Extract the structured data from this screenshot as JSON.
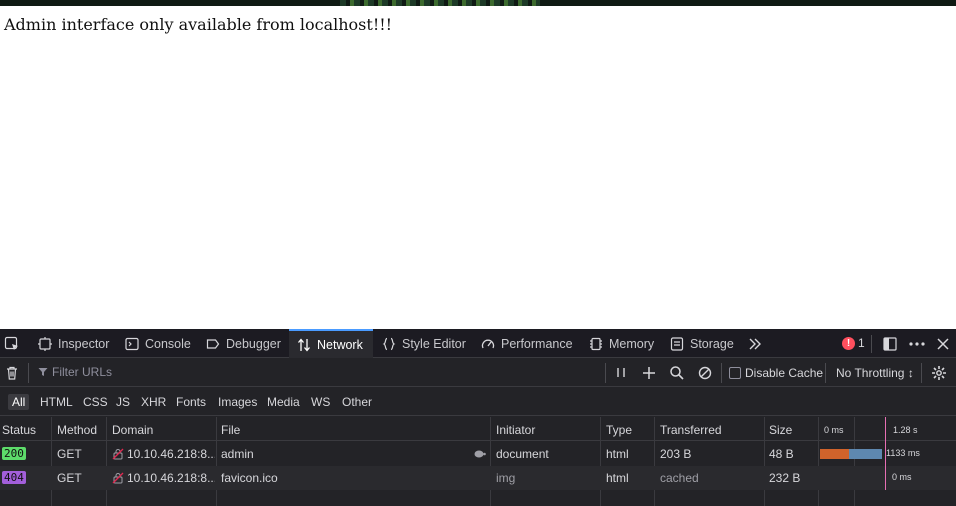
{
  "page": {
    "message": "Admin interface only available from localhost!!!"
  },
  "devtools": {
    "tabs": [
      {
        "label": "Inspector"
      },
      {
        "label": "Console"
      },
      {
        "label": "Debugger"
      },
      {
        "label": "Network"
      },
      {
        "label": "Style Editor"
      },
      {
        "label": "Performance"
      },
      {
        "label": "Memory"
      },
      {
        "label": "Storage"
      }
    ],
    "active_tab": "Network",
    "error_count": "1",
    "toolbar": {
      "filter_placeholder": "Filter URLs",
      "disable_cache_label": "Disable Cache",
      "throttling_label": "No Throttling ↕"
    },
    "type_filters": [
      "All",
      "HTML",
      "CSS",
      "JS",
      "XHR",
      "Fonts",
      "Images",
      "Media",
      "WS",
      "Other"
    ],
    "active_type_filter": "All",
    "columns": [
      "Status",
      "Method",
      "Domain",
      "File",
      "Initiator",
      "Type",
      "Transferred",
      "Size"
    ],
    "waterfall_ticks": [
      "0 ms",
      "1.28 s"
    ],
    "rows": [
      {
        "status": "200",
        "status_color": "#5ddb6a",
        "method": "GET",
        "domain": "10.10.46.218:8...",
        "file": "admin",
        "initiator": "document",
        "type": "html",
        "transferred": "203 B",
        "size": "48 B",
        "timing": "1133 ms"
      },
      {
        "status": "404",
        "status_color": "#a35fdb",
        "method": "GET",
        "domain": "10.10.46.218:8...",
        "file": "favicon.ico",
        "initiator": "img",
        "type": "html",
        "transferred": "cached",
        "size": "232 B",
        "timing": "0 ms"
      }
    ]
  },
  "colors": {
    "accent": "#4a9bff",
    "error": "#ff4f5e",
    "devtools_bg": "#232327"
  }
}
